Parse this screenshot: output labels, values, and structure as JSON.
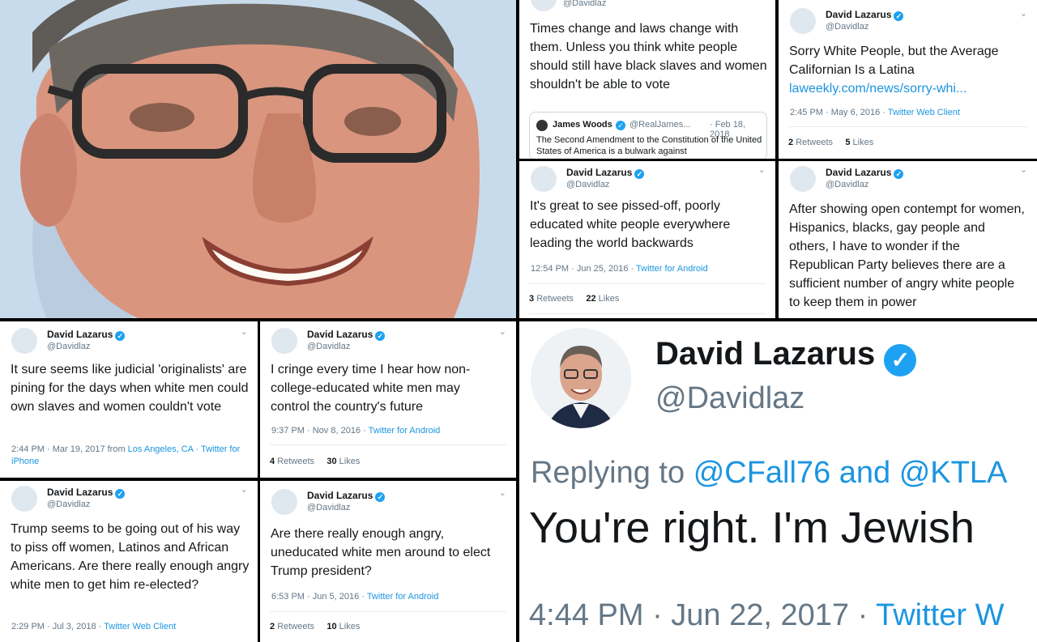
{
  "profile": {
    "name": "David Lazarus",
    "handle": "@Davidlaz"
  },
  "tweets": [
    {
      "text": "Times change and laws change with them. Unless you think white people should still have black slaves and women shouldn't be able to vote",
      "quote": {
        "name": "James Woods",
        "handle": "@RealJames...",
        "date": "· Feb 18, 2018",
        "text": "The Second Amendment to the Constitution of the United States of America is a bulwark against"
      }
    },
    {
      "text": "Sorry White People, but the Average Californian Is a Latina",
      "link": "laweekly.com/news/sorry-whi...",
      "time": "2:45 PM · May 6, 2016 · ",
      "source": "Twitter Web Client",
      "retweets": "2",
      "retweets_label": "Retweets",
      "likes": "5",
      "likes_label": "Likes"
    },
    {
      "text": "It's great to see pissed-off, poorly educated white people everywhere leading the world backwards",
      "time": "12:54 PM · Jun 25, 2016 · ",
      "source": "Twitter for Android",
      "retweets": "3",
      "retweets_label": "Retweets",
      "likes": "22",
      "likes_label": "Likes"
    },
    {
      "text": "After showing open contempt for women, Hispanics, blacks, gay people and others, I have to wonder if the Republican Party believes there are a sufficient number of angry white people to keep them in power"
    },
    {
      "text": "It sure seems like judicial 'originalists' are pining for the days when white men could own slaves and women couldn't vote",
      "time": "2:44 PM · Mar 19, 2017 from ",
      "location": "Los Angeles, CA",
      "source": " · Twitter for iPhone"
    },
    {
      "text": "I cringe every time I hear how non-college-educated white men may control the country's future",
      "time": "9:37 PM · Nov 8, 2016 · ",
      "source": "Twitter for Android",
      "retweets": "4",
      "retweets_label": "Retweets",
      "likes": "30",
      "likes_label": "Likes"
    },
    {
      "text": "Trump seems to be going out of his way to piss off women, Latinos and African Americans. Are there really enough angry white men to get him re-elected?",
      "time": "2:29 PM · Jul 3, 2018 · ",
      "source": "Twitter Web Client"
    },
    {
      "text": "Are there really enough angry, uneducated white men around to elect Trump president?",
      "time": "6:53 PM · Jun 5, 2016 · ",
      "source": "Twitter for Android",
      "retweets": "2",
      "retweets_label": "Retweets",
      "likes": "10",
      "likes_label": "Likes"
    }
  ],
  "big": {
    "replying_prefix": "Replying to",
    "replying_users": "@CFall76 and @KTLA",
    "text": "You're right. I'm Jewish",
    "time": "4:44 PM · Jun 22, 2017 · ",
    "source": "Twitter W"
  },
  "colors": {
    "link": "#1b95e0",
    "verified": "#1da1f2",
    "muted": "#657786"
  }
}
